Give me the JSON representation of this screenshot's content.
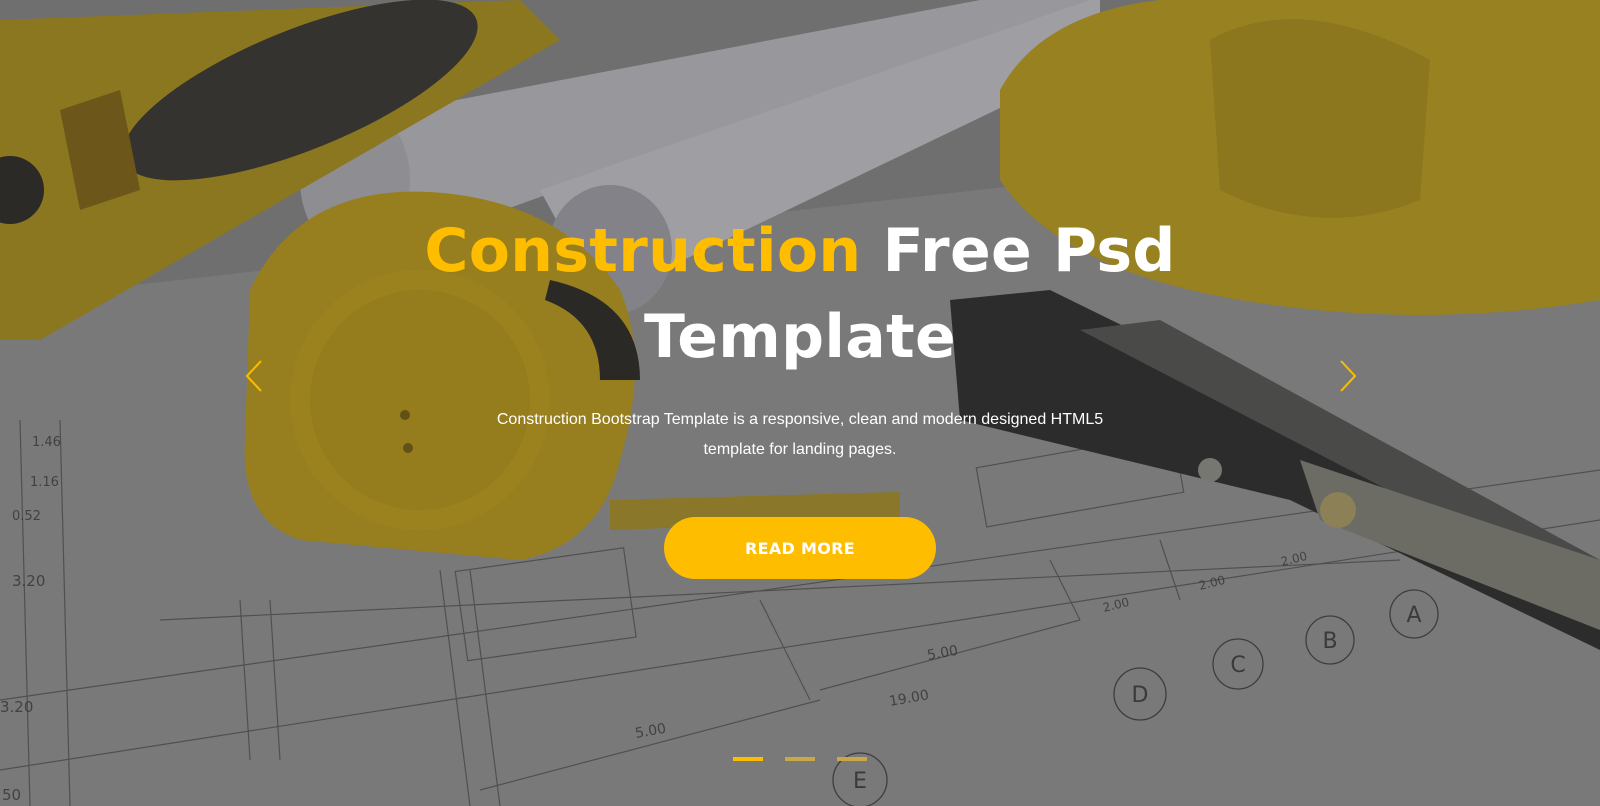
{
  "hero": {
    "headline_accent": "Construction",
    "headline_line1_rest": " Free Psd",
    "headline_line2": "Template",
    "description": "Construction Bootstrap Template is a responsive, clean and modern designed HTML5 template for landing pages.",
    "cta_label": "READ MORE",
    "accent_color": "#ffbd00"
  },
  "carousel": {
    "prev_icon": "chevron-left-icon",
    "next_icon": "chevron-right-icon",
    "slide_count": 3,
    "active_slide": 1
  },
  "background_labels": [
    "1.46",
    "1.16",
    "0.52",
    "3.20",
    "3.20",
    "50",
    "5.00",
    "19.00",
    "5.00",
    "2.00",
    "2.00",
    "2.00",
    "A",
    "B",
    "C",
    "D",
    "E"
  ]
}
